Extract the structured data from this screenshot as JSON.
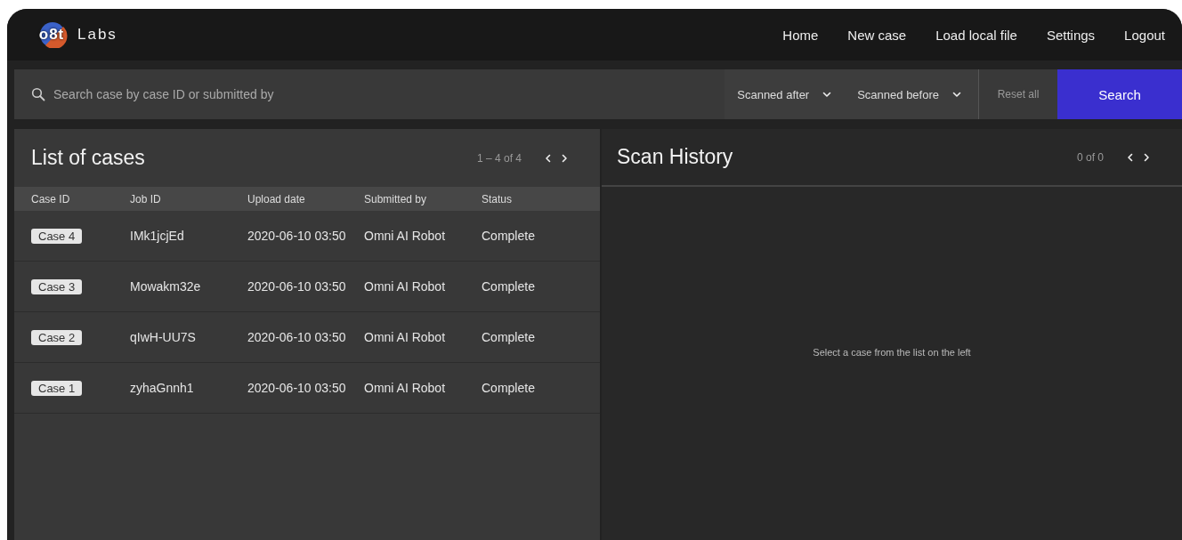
{
  "logo": {
    "mark": "o8t",
    "name": "Labs"
  },
  "nav": [
    "Home",
    "New case",
    "Load local file",
    "Settings",
    "Logout"
  ],
  "search": {
    "placeholder": "Search case by case ID or submitted by",
    "filters": [
      "Scanned after",
      "Scanned before"
    ],
    "reset": "Reset all",
    "button": "Search"
  },
  "cases": {
    "title": "List of cases",
    "pagination": "1 – 4 of 4",
    "columns": [
      "Case ID",
      "Job ID",
      "Upload date",
      "Submitted by",
      "Status"
    ],
    "rows": [
      {
        "case_id": "Case 4",
        "job_id": "IMk1jcjEd",
        "upload_date": "2020-06-10 03:50",
        "submitted_by": "Omni AI Robot",
        "status": "Complete"
      },
      {
        "case_id": "Case 3",
        "job_id": "Mowakm32e",
        "upload_date": "2020-06-10 03:50",
        "submitted_by": "Omni AI Robot",
        "status": "Complete"
      },
      {
        "case_id": "Case 2",
        "job_id": "qIwH-UU7S",
        "upload_date": "2020-06-10 03:50",
        "submitted_by": "Omni AI Robot",
        "status": "Complete"
      },
      {
        "case_id": "Case 1",
        "job_id": "zyhaGnnh1",
        "upload_date": "2020-06-10 03:50",
        "submitted_by": "Omni AI Robot",
        "status": "Complete"
      }
    ]
  },
  "history": {
    "title": "Scan History",
    "pagination": "0 of 0",
    "empty_message": "Select a case from the list on the left"
  }
}
